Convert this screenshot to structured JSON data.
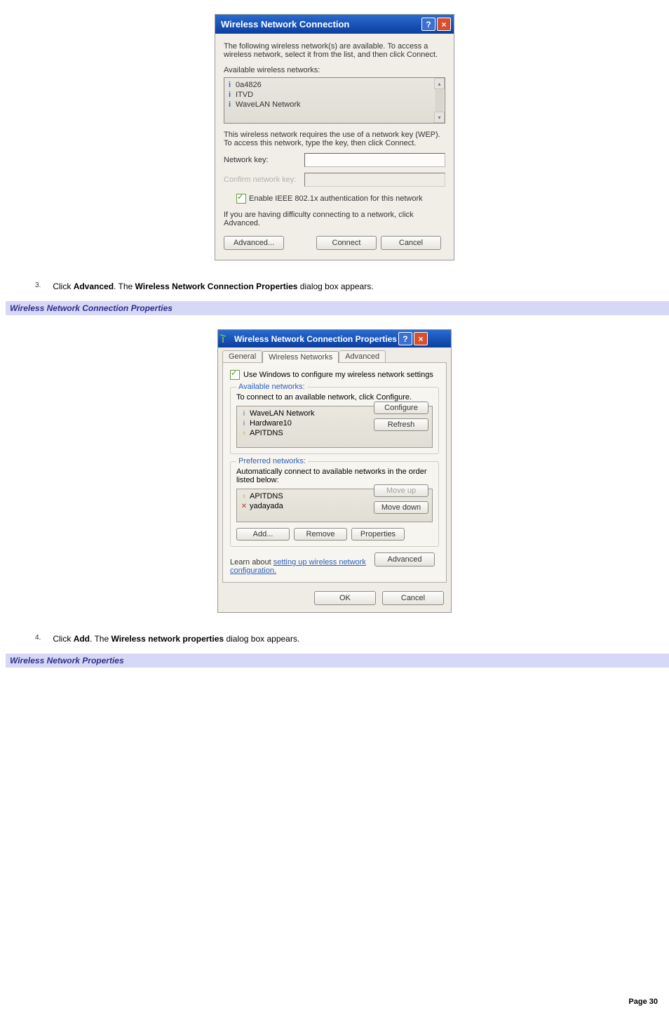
{
  "dialog1": {
    "title": "Wireless Network Connection",
    "intro": "The following wireless network(s) are available. To access a wireless network, select it from the list, and then click Connect.",
    "available_label": "Available wireless networks:",
    "networks": [
      "0a4826",
      "ITVD",
      "WaveLAN Network"
    ],
    "wep_text": "This wireless network requires the use of a network key (WEP). To access this network, type the key, then click Connect.",
    "netkey_label": "Network key:",
    "confirm_label": "Confirm network key:",
    "ieee_label": "Enable IEEE 802.1x authentication for this network",
    "difficulty_text": "If you are having difficulty connecting to a network, click Advanced.",
    "advanced_btn": "Advanced...",
    "connect_btn": "Connect",
    "cancel_btn": "Cancel"
  },
  "step3": {
    "num": "3.",
    "pre": "Click ",
    "bold1": "Advanced",
    "mid": ". The ",
    "bold2": "Wireless Network Connection Properties",
    "post": " dialog box appears."
  },
  "heading1": "Wireless Network Connection Properties",
  "dialog2": {
    "title": "Wireless Network Connection Properties",
    "tabs": {
      "general": "General",
      "wireless": "Wireless Networks",
      "advanced": "Advanced"
    },
    "use_windows": "Use Windows to configure my wireless network settings",
    "available": {
      "legend": "Available networks:",
      "desc": "To connect to an available network, click Configure.",
      "items": [
        "WaveLAN Network",
        "Hardware10",
        "APITDNS"
      ],
      "configure": "Configure",
      "refresh": "Refresh"
    },
    "preferred": {
      "legend": "Preferred networks:",
      "desc": "Automatically connect to available networks in the order listed below:",
      "items": [
        "APITDNS",
        "yadayada"
      ],
      "moveup": "Move up",
      "movedown": "Move down",
      "add": "Add...",
      "remove": "Remove",
      "properties": "Properties"
    },
    "learn_pre": "Learn about ",
    "learn_link": "setting up wireless network configuration.",
    "advanced_btn": "Advanced",
    "ok": "OK",
    "cancel": "Cancel"
  },
  "step4": {
    "num": "4.",
    "pre": "Click ",
    "bold1": "Add",
    "mid": ". The ",
    "bold2": "Wireless network properties",
    "post": " dialog box appears."
  },
  "heading2": "Wireless Network Properties",
  "page_label": "Page 30"
}
